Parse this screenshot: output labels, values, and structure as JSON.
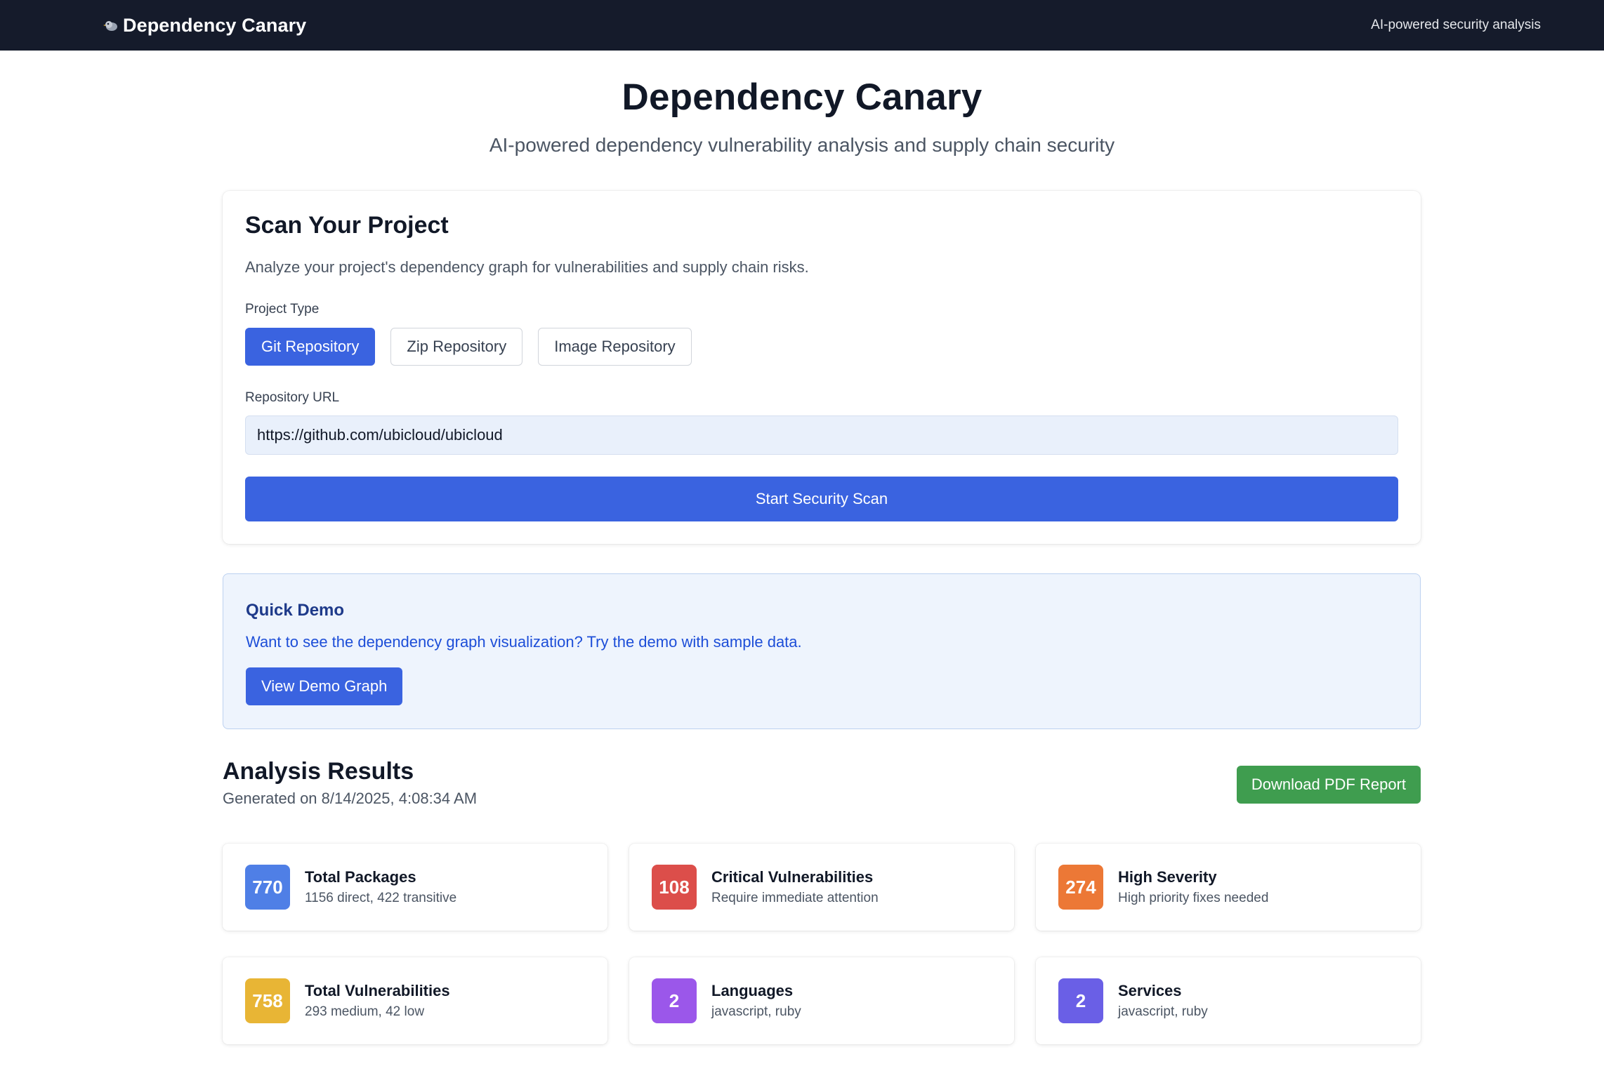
{
  "nav": {
    "brand": "Dependency Canary",
    "brand_icon": "canary-bird-icon",
    "tagline": "AI-powered security analysis"
  },
  "hero": {
    "title": "Dependency Canary",
    "subtitle": "AI-powered dependency vulnerability analysis and supply chain security"
  },
  "scan": {
    "title": "Scan Your Project",
    "description": "Analyze your project's dependency graph for vulnerabilities and supply chain risks.",
    "project_type_label": "Project Type",
    "types": [
      {
        "label": "Git Repository",
        "selected": true
      },
      {
        "label": "Zip Repository",
        "selected": false
      },
      {
        "label": "Image Repository",
        "selected": false
      }
    ],
    "url_label": "Repository URL",
    "url_value": "https://github.com/ubicloud/ubicloud",
    "submit_label": "Start Security Scan"
  },
  "demo": {
    "title": "Quick Demo",
    "description": "Want to see the dependency graph visualization? Try the demo with sample data.",
    "button_label": "View Demo Graph"
  },
  "results": {
    "title": "Analysis Results",
    "generated": "Generated on 8/14/2025, 4:08:34 AM",
    "pdf_button_label": "Download PDF Report",
    "stats": [
      {
        "value": "770",
        "label": "Total Packages",
        "sub": "1156 direct, 422 transitive",
        "color": "#4f7fe6"
      },
      {
        "value": "108",
        "label": "Critical Vulnerabilities",
        "sub": "Require immediate attention",
        "color": "#dc4e4a"
      },
      {
        "value": "274",
        "label": "High Severity",
        "sub": "High priority fixes needed",
        "color": "#ec7836"
      },
      {
        "value": "758",
        "label": "Total Vulnerabilities",
        "sub": "293 medium, 42 low",
        "color": "#e8b535"
      },
      {
        "value": "2",
        "label": "Languages",
        "sub": "javascript, ruby",
        "color": "#9b57ea"
      },
      {
        "value": "2",
        "label": "Services",
        "sub": "javascript, ruby",
        "color": "#6a5fe6"
      }
    ]
  },
  "colors": {
    "nav_bg": "#151b2b",
    "primary": "#3a63e0",
    "success": "#3f9d4f",
    "demo_bg": "#eef4fd"
  }
}
